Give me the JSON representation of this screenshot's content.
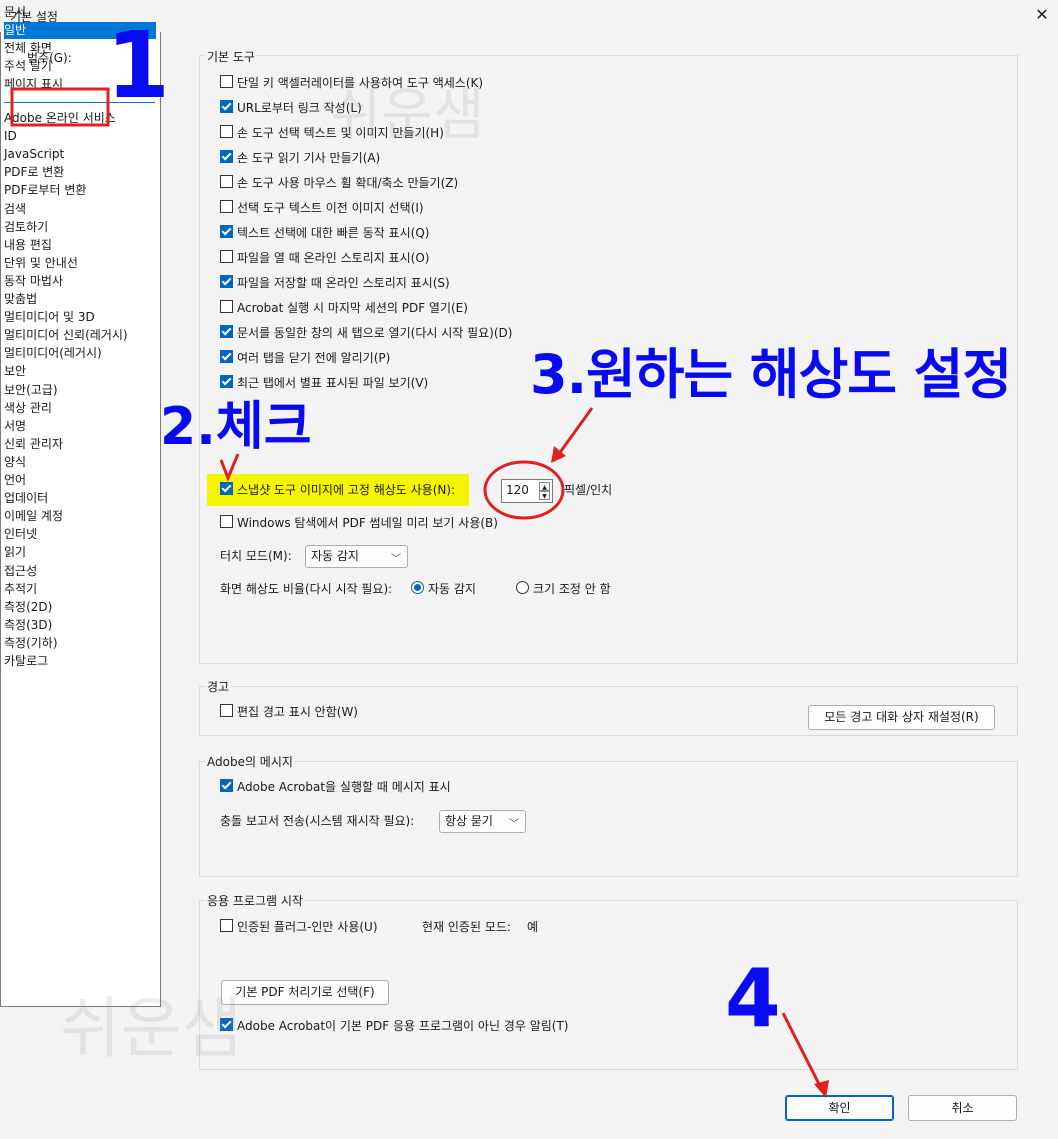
{
  "window": {
    "title": "기본 설정",
    "close_glyph": "✕"
  },
  "categories": {
    "label": "범주(G):",
    "items": [
      "문서",
      "일반",
      "전체 화면",
      "주석 달기",
      "페이지 표시",
      "Adobe 온라인 서비스",
      "ID",
      "JavaScript",
      "PDF로 변환",
      "PDF로부터 변환",
      "검색",
      "검토하기",
      "내용 편집",
      "단위 및 안내선",
      "동작 마법사",
      "맞춤법",
      "멀티미디어 및 3D",
      "멀티미디어 신뢰(레거시)",
      "멀티미디어(레거시)",
      "보안",
      "보안(고급)",
      "색상 관리",
      "서명",
      "신뢰 관리자",
      "양식",
      "언어",
      "업데이터",
      "이메일 계정",
      "인터넷",
      "읽기",
      "접근성",
      "추적기",
      "측정(2D)",
      "측정(3D)",
      "측정(기하)",
      "카탈로그"
    ],
    "selected": "일반"
  },
  "basic_tools": {
    "label": "기본 도구",
    "options": [
      {
        "label": "단일 키 액셀러레이터를 사용하여 도구 액세스(K)",
        "checked": false
      },
      {
        "label": "URL로부터 링크 작성(L)",
        "checked": true
      },
      {
        "label": "손 도구 선택 텍스트 및 이미지 만들기(H)",
        "checked": false
      },
      {
        "label": "손 도구 읽기 기사 만들기(A)",
        "checked": true
      },
      {
        "label": "손 도구 사용 마우스 휠 확대/축소 만들기(Z)",
        "checked": false
      },
      {
        "label": "선택 도구 텍스트 이전 이미지 선택(I)",
        "checked": false
      },
      {
        "label": "텍스트 선택에 대한 빠른 동작 표시(Q)",
        "checked": true
      },
      {
        "label": "파일을 열 때 온라인 스토리지 표시(O)",
        "checked": false
      },
      {
        "label": "파일을 저장할 때 온라인 스토리지 표시(S)",
        "checked": true
      },
      {
        "label": "Acrobat 실행 시 마지막 세션의 PDF 열기(E)",
        "checked": false
      },
      {
        "label": "문서를 동일한 창의 새 탭으로 열기(다시 시작 필요)(D)",
        "checked": true
      },
      {
        "label": "여러 탭을 닫기 전에 알리기(P)",
        "checked": true
      },
      {
        "label": "최근 탭에서 별표 표시된 파일 보기(V)",
        "checked": true
      }
    ],
    "snapshot_label": "스냅샷 도구 이미지에 고정 해상도 사용(N):",
    "snapshot_checked": true,
    "snapshot_value": "120",
    "snapshot_unit": "픽셀/인치",
    "windows_thumb_label": "Windows 탐색에서 PDF 썸네일 미리 보기 사용(B)",
    "windows_thumb_checked": false,
    "touch_label": "터치 모드(M):",
    "touch_value": "자동 감지",
    "scale_label": "화면 해상도 비율(다시 시작 필요):",
    "scale_options": [
      {
        "label": "자동 감지",
        "selected": true
      },
      {
        "label": "크기 조정 안 함",
        "selected": false
      }
    ]
  },
  "warning": {
    "label": "경고",
    "no_edit_warn_label": "편집 경고 표시 안함(W)",
    "no_edit_warn_checked": false,
    "reset_button": "모든 경고 대화 상자 재설정(R)"
  },
  "adobe_messages": {
    "label": "Adobe의 메시지",
    "show_msg_label": "Adobe Acrobat을 실행할 때 메시지 표시",
    "show_msg_checked": true,
    "crash_label": "충돌 보고서 전송(시스템 재시작 필요):",
    "crash_value": "항상 묻기"
  },
  "app_start": {
    "label": "응용 프로그램 시작",
    "certified_label": "인증된 플러그-인만 사용(U)",
    "certified_checked": false,
    "current_mode_label": "현재 인증된 모드:",
    "current_mode_value": "예",
    "default_pdf_button": "기본 PDF 처리기로 선택(F)",
    "notify_label": "Adobe Acrobat이 기본 PDF 응용 프로그램이 아닌 경우 알림(T)",
    "notify_checked": true
  },
  "footer": {
    "ok": "확인",
    "cancel": "취소"
  },
  "annotations": {
    "step1": "1",
    "step2": "2.체크",
    "step3": "3.원하는 해상도 설정",
    "step4": "4",
    "color": "#0a0af0",
    "mark_color": "#e02020"
  },
  "watermark": "쉬운샘"
}
